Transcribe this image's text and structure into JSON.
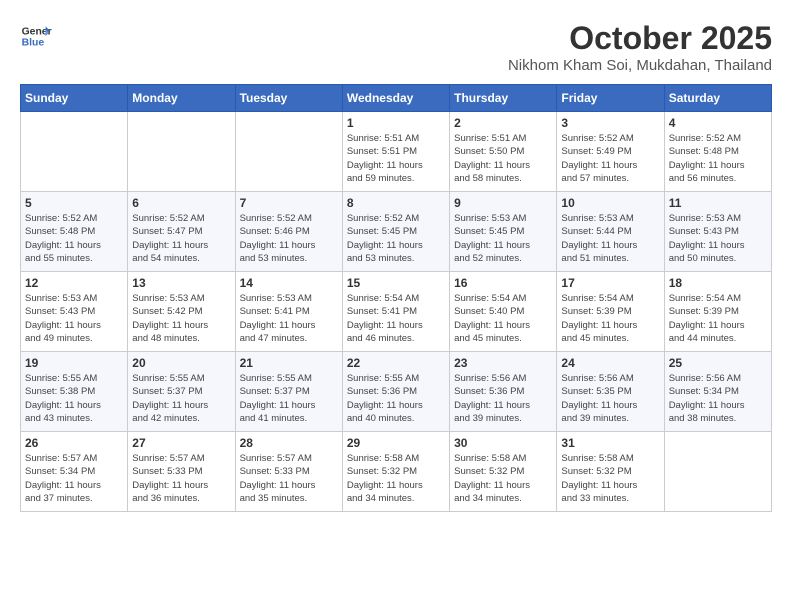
{
  "header": {
    "logo_line1": "General",
    "logo_line2": "Blue",
    "month": "October 2025",
    "location": "Nikhom Kham Soi, Mukdahan, Thailand"
  },
  "weekdays": [
    "Sunday",
    "Monday",
    "Tuesday",
    "Wednesday",
    "Thursday",
    "Friday",
    "Saturday"
  ],
  "weeks": [
    [
      {
        "day": "",
        "info": ""
      },
      {
        "day": "",
        "info": ""
      },
      {
        "day": "",
        "info": ""
      },
      {
        "day": "1",
        "info": "Sunrise: 5:51 AM\nSunset: 5:51 PM\nDaylight: 11 hours\nand 59 minutes."
      },
      {
        "day": "2",
        "info": "Sunrise: 5:51 AM\nSunset: 5:50 PM\nDaylight: 11 hours\nand 58 minutes."
      },
      {
        "day": "3",
        "info": "Sunrise: 5:52 AM\nSunset: 5:49 PM\nDaylight: 11 hours\nand 57 minutes."
      },
      {
        "day": "4",
        "info": "Sunrise: 5:52 AM\nSunset: 5:48 PM\nDaylight: 11 hours\nand 56 minutes."
      }
    ],
    [
      {
        "day": "5",
        "info": "Sunrise: 5:52 AM\nSunset: 5:48 PM\nDaylight: 11 hours\nand 55 minutes."
      },
      {
        "day": "6",
        "info": "Sunrise: 5:52 AM\nSunset: 5:47 PM\nDaylight: 11 hours\nand 54 minutes."
      },
      {
        "day": "7",
        "info": "Sunrise: 5:52 AM\nSunset: 5:46 PM\nDaylight: 11 hours\nand 53 minutes."
      },
      {
        "day": "8",
        "info": "Sunrise: 5:52 AM\nSunset: 5:45 PM\nDaylight: 11 hours\nand 53 minutes."
      },
      {
        "day": "9",
        "info": "Sunrise: 5:53 AM\nSunset: 5:45 PM\nDaylight: 11 hours\nand 52 minutes."
      },
      {
        "day": "10",
        "info": "Sunrise: 5:53 AM\nSunset: 5:44 PM\nDaylight: 11 hours\nand 51 minutes."
      },
      {
        "day": "11",
        "info": "Sunrise: 5:53 AM\nSunset: 5:43 PM\nDaylight: 11 hours\nand 50 minutes."
      }
    ],
    [
      {
        "day": "12",
        "info": "Sunrise: 5:53 AM\nSunset: 5:43 PM\nDaylight: 11 hours\nand 49 minutes."
      },
      {
        "day": "13",
        "info": "Sunrise: 5:53 AM\nSunset: 5:42 PM\nDaylight: 11 hours\nand 48 minutes."
      },
      {
        "day": "14",
        "info": "Sunrise: 5:53 AM\nSunset: 5:41 PM\nDaylight: 11 hours\nand 47 minutes."
      },
      {
        "day": "15",
        "info": "Sunrise: 5:54 AM\nSunset: 5:41 PM\nDaylight: 11 hours\nand 46 minutes."
      },
      {
        "day": "16",
        "info": "Sunrise: 5:54 AM\nSunset: 5:40 PM\nDaylight: 11 hours\nand 45 minutes."
      },
      {
        "day": "17",
        "info": "Sunrise: 5:54 AM\nSunset: 5:39 PM\nDaylight: 11 hours\nand 45 minutes."
      },
      {
        "day": "18",
        "info": "Sunrise: 5:54 AM\nSunset: 5:39 PM\nDaylight: 11 hours\nand 44 minutes."
      }
    ],
    [
      {
        "day": "19",
        "info": "Sunrise: 5:55 AM\nSunset: 5:38 PM\nDaylight: 11 hours\nand 43 minutes."
      },
      {
        "day": "20",
        "info": "Sunrise: 5:55 AM\nSunset: 5:37 PM\nDaylight: 11 hours\nand 42 minutes."
      },
      {
        "day": "21",
        "info": "Sunrise: 5:55 AM\nSunset: 5:37 PM\nDaylight: 11 hours\nand 41 minutes."
      },
      {
        "day": "22",
        "info": "Sunrise: 5:55 AM\nSunset: 5:36 PM\nDaylight: 11 hours\nand 40 minutes."
      },
      {
        "day": "23",
        "info": "Sunrise: 5:56 AM\nSunset: 5:36 PM\nDaylight: 11 hours\nand 39 minutes."
      },
      {
        "day": "24",
        "info": "Sunrise: 5:56 AM\nSunset: 5:35 PM\nDaylight: 11 hours\nand 39 minutes."
      },
      {
        "day": "25",
        "info": "Sunrise: 5:56 AM\nSunset: 5:34 PM\nDaylight: 11 hours\nand 38 minutes."
      }
    ],
    [
      {
        "day": "26",
        "info": "Sunrise: 5:57 AM\nSunset: 5:34 PM\nDaylight: 11 hours\nand 37 minutes."
      },
      {
        "day": "27",
        "info": "Sunrise: 5:57 AM\nSunset: 5:33 PM\nDaylight: 11 hours\nand 36 minutes."
      },
      {
        "day": "28",
        "info": "Sunrise: 5:57 AM\nSunset: 5:33 PM\nDaylight: 11 hours\nand 35 minutes."
      },
      {
        "day": "29",
        "info": "Sunrise: 5:58 AM\nSunset: 5:32 PM\nDaylight: 11 hours\nand 34 minutes."
      },
      {
        "day": "30",
        "info": "Sunrise: 5:58 AM\nSunset: 5:32 PM\nDaylight: 11 hours\nand 34 minutes."
      },
      {
        "day": "31",
        "info": "Sunrise: 5:58 AM\nSunset: 5:32 PM\nDaylight: 11 hours\nand 33 minutes."
      },
      {
        "day": "",
        "info": ""
      }
    ]
  ]
}
